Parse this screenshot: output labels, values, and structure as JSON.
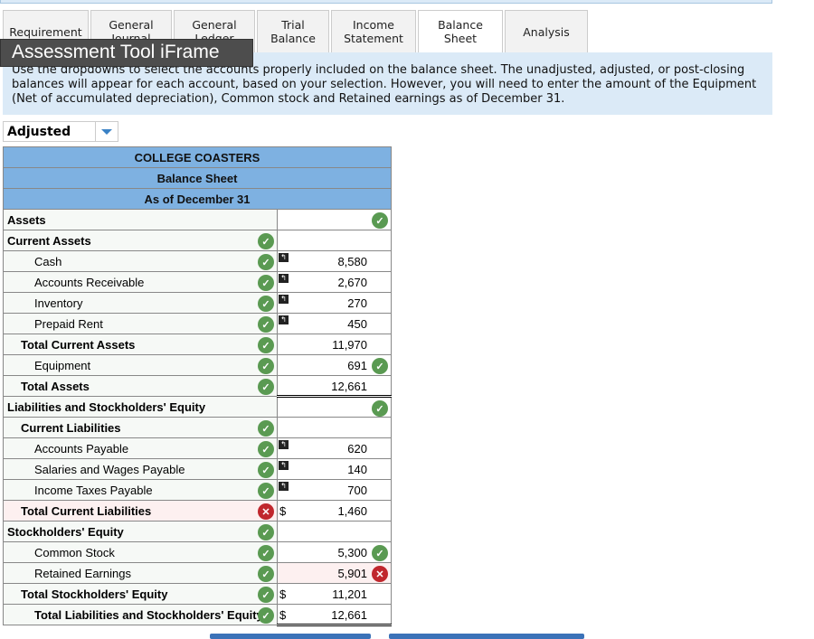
{
  "tabs": [
    {
      "label": "Requirement"
    },
    {
      "label": "General Journal"
    },
    {
      "label": "General Ledger"
    },
    {
      "label": "Trial Balance"
    },
    {
      "label": "Income Statement"
    },
    {
      "label": "Balance Sheet",
      "active": true
    },
    {
      "label": "Analysis"
    }
  ],
  "overlay_label": "Assessment Tool iFrame",
  "instructions": "Use the dropdowns to select the accounts properly included on the balance sheet. The unadjusted, adjusted, or post-closing balances will appear for each account, based on your selection. However, you will need to enter the amount of the Equipment (Net of accumulated depreciation), Common stock and Retained earnings as of December 31.",
  "balance_type": "Adjusted",
  "sheet": {
    "company": "COLLEGE COASTERS",
    "title": "Balance Sheet",
    "date": "As of December 31",
    "rows": [
      {
        "label": "Assets",
        "indent": 0,
        "bold": true,
        "value_status": "correct"
      },
      {
        "label": "Current Assets",
        "indent": 0,
        "bold": true,
        "status": "correct"
      },
      {
        "label": "Cash",
        "indent": 2,
        "status": "correct",
        "arrow": true,
        "value": "8,580"
      },
      {
        "label": "Accounts Receivable",
        "indent": 2,
        "status": "correct",
        "arrow": true,
        "value": "2,670"
      },
      {
        "label": "Inventory",
        "indent": 2,
        "status": "correct",
        "arrow": true,
        "value": "270"
      },
      {
        "label": "Prepaid Rent",
        "indent": 2,
        "status": "correct",
        "arrow": true,
        "value": "450"
      },
      {
        "label": "Total Current Assets",
        "indent": 1,
        "bold": true,
        "status": "correct",
        "value": "11,970",
        "topline": true
      },
      {
        "label": "Equipment",
        "indent": 2,
        "status": "correct",
        "value": "691",
        "value_status": "correct"
      },
      {
        "label": "Total Assets",
        "indent": 1,
        "bold": true,
        "status": "correct",
        "value": "12,661",
        "topline": true,
        "double": true
      },
      {
        "label": "Liabilities and Stockholders' Equity",
        "indent": 0,
        "bold": true,
        "value_status": "correct"
      },
      {
        "label": "Current Liabilities",
        "indent": 1,
        "bold": true,
        "status": "correct"
      },
      {
        "label": "Accounts Payable",
        "indent": 2,
        "status": "correct",
        "arrow": true,
        "value": "620"
      },
      {
        "label": "Salaries and Wages Payable",
        "indent": 2,
        "status": "correct",
        "arrow": true,
        "value": "140"
      },
      {
        "label": "Income Taxes Payable",
        "indent": 2,
        "status": "correct",
        "arrow": true,
        "value": "700"
      },
      {
        "label": "Total Current Liabilities",
        "indent": 1,
        "bold": true,
        "status": "incorrect",
        "dollar": "$",
        "value": "1,460",
        "topline": true
      },
      {
        "label": "Stockholders' Equity",
        "indent": 0,
        "bold": true,
        "status": "correct"
      },
      {
        "label": "Common Stock",
        "indent": 2,
        "status": "correct",
        "value": "5,300",
        "value_status": "correct"
      },
      {
        "label": "Retained Earnings",
        "indent": 2,
        "status": "correct",
        "value": "5,901",
        "value_status": "incorrect"
      },
      {
        "label": "Total Stockholders' Equity",
        "indent": 1,
        "bold": true,
        "status": "correct",
        "dollar": "$",
        "value": "11,201",
        "topline": true
      },
      {
        "label": "Total Liabilities and Stockholders' Equity",
        "indent": 2,
        "bold": true,
        "status": "correct",
        "dollar": "$",
        "value": "12,661",
        "double": true
      }
    ]
  },
  "colors": {
    "header": "#7eb1e1",
    "correct": "#5a9a52",
    "incorrect": "#c0272d",
    "info_bg": "#dbeaf7"
  }
}
